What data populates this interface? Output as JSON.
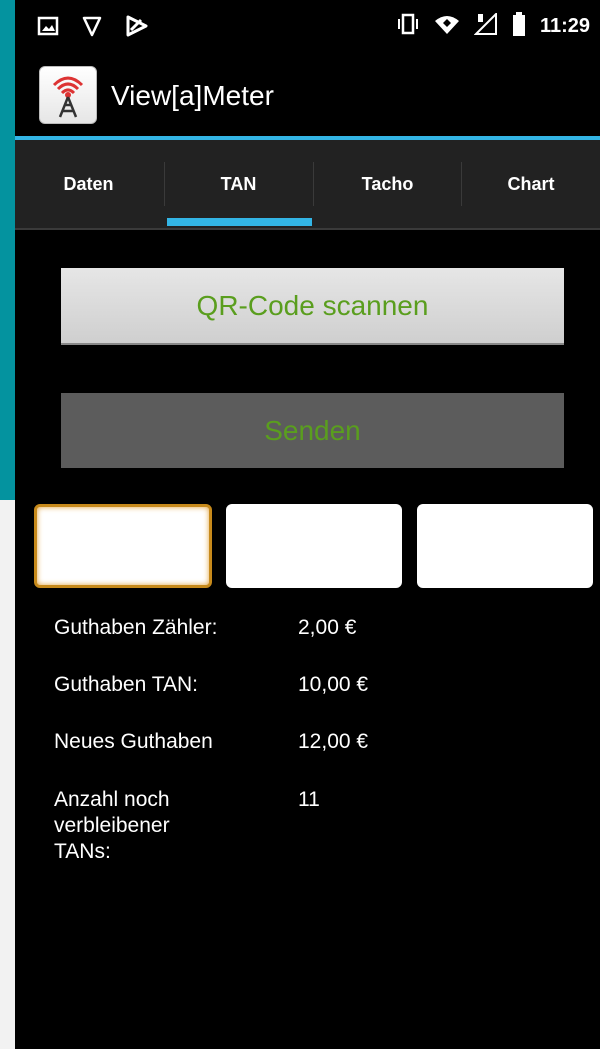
{
  "status_bar": {
    "time": "11:29",
    "icons_left": [
      "gallery-icon",
      "shield-icon",
      "app-notification-icon"
    ],
    "icons_right": [
      "vibrate-icon",
      "wifi-icon",
      "signal-icon",
      "battery-icon"
    ]
  },
  "app": {
    "title": "View[a]Meter",
    "icon": "radio-tower-icon"
  },
  "tabs": [
    {
      "label": "Daten",
      "selected": false
    },
    {
      "label": "TAN",
      "selected": true
    },
    {
      "label": "Tacho",
      "selected": false
    },
    {
      "label": "Chart",
      "selected": false
    }
  ],
  "buttons": {
    "scan_label": "QR-Code scannen",
    "send_label": "Senden"
  },
  "tan_fields": {
    "field1": "",
    "field2": "",
    "field3": ""
  },
  "info": {
    "guthaben_zaehler_label": "Guthaben Zähler:",
    "guthaben_zaehler_value": "2,00 €",
    "guthaben_tan_label": "Guthaben TAN:",
    "guthaben_tan_value": "10,00 €",
    "neues_guthaben_label": "Neues Guthaben",
    "neues_guthaben_value": "12,00 €",
    "anzahl_label": "Anzahl noch verbleibener TANs:",
    "anzahl_value": "11"
  },
  "colors": {
    "accent": "#33b5e5",
    "button_text": "#5a9e1e",
    "background_teal": "#04939f",
    "focus_border": "#c78a1b"
  }
}
